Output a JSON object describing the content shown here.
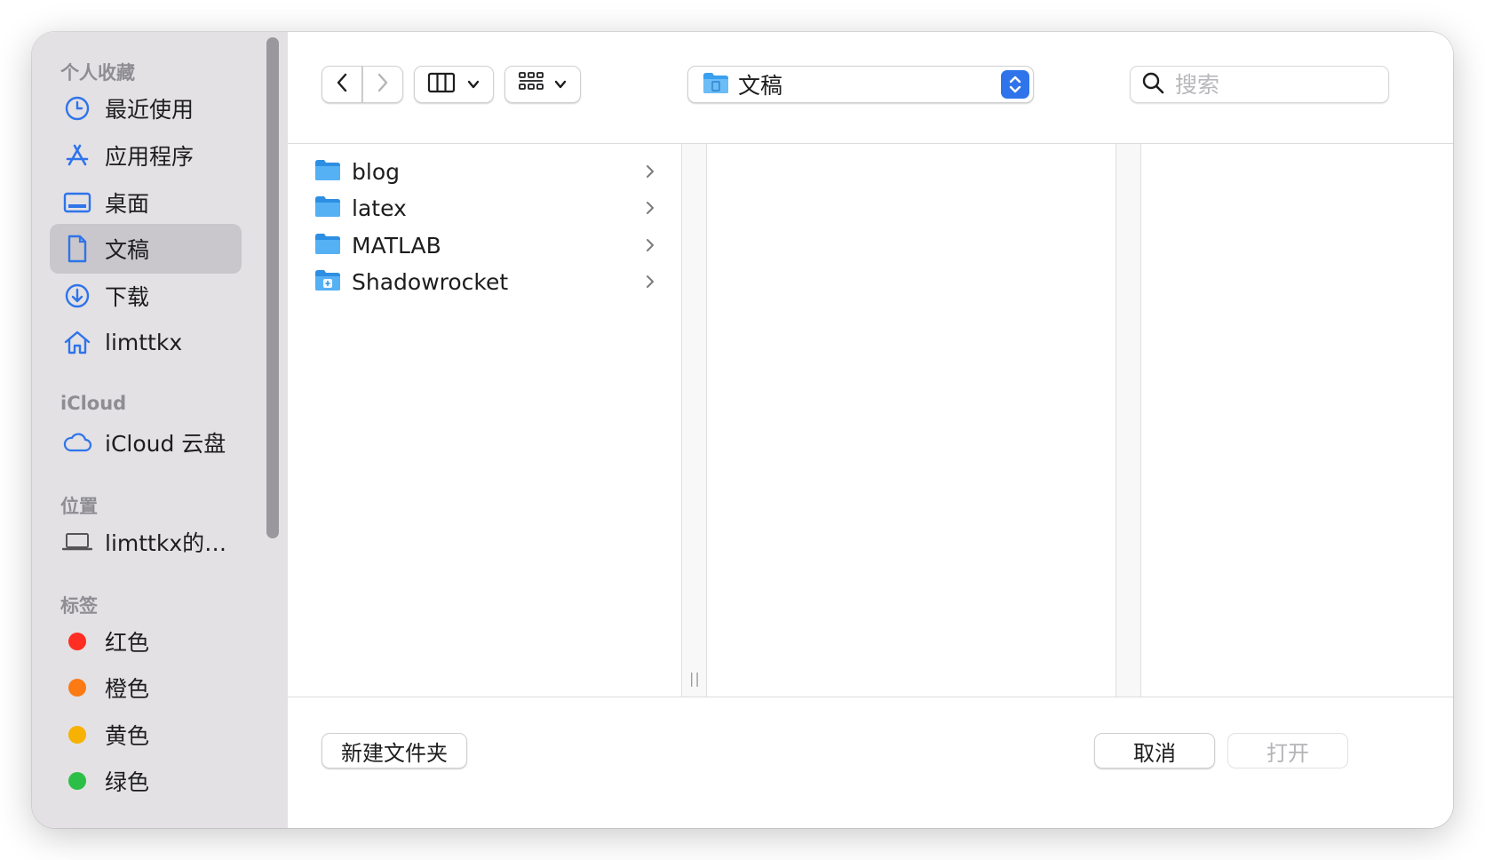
{
  "sidebar": {
    "favorites_header": "个人收藏",
    "favorites": [
      {
        "label": "最近使用",
        "icon": "clock-icon"
      },
      {
        "label": "应用程序",
        "icon": "app-store-icon"
      },
      {
        "label": "桌面",
        "icon": "desktop-icon"
      },
      {
        "label": "文稿",
        "icon": "document-icon",
        "selected": true
      },
      {
        "label": "下载",
        "icon": "download-icon"
      },
      {
        "label": "limttkx",
        "icon": "home-icon"
      }
    ],
    "icloud_header": "iCloud",
    "icloud": [
      {
        "label": "iCloud 云盘",
        "icon": "cloud-icon"
      }
    ],
    "locations_header": "位置",
    "locations": [
      {
        "label": "limttkx的…",
        "icon": "laptop-icon"
      }
    ],
    "tags_header": "标签",
    "tags": [
      {
        "label": "红色",
        "color": "#ff2d22"
      },
      {
        "label": "橙色",
        "color": "#fb7a13"
      },
      {
        "label": "黄色",
        "color": "#f7b100"
      },
      {
        "label": "绿色",
        "color": "#2bbf48"
      }
    ]
  },
  "toolbar": {
    "back_icon": "chevron-left-icon",
    "forward_icon": "chevron-right-icon",
    "view_mode_icon": "columns-view-icon",
    "group_icon": "grid-group-icon",
    "path_label": "文稿",
    "search_placeholder": "搜索"
  },
  "browser": {
    "column1": [
      {
        "name": "blog",
        "icon": "folder-icon"
      },
      {
        "name": "latex",
        "icon": "folder-icon"
      },
      {
        "name": "MATLAB",
        "icon": "folder-icon"
      },
      {
        "name": "Shadowrocket",
        "icon": "app-folder-icon"
      }
    ],
    "resize_handle": "||"
  },
  "footer": {
    "new_folder_label": "新建文件夹",
    "cancel_label": "取消",
    "open_label": "打开"
  },
  "colors": {
    "sidebar_bg": "#e3e1e4",
    "selection_bg": "#c9c7cb",
    "accent": "#2f74ea",
    "folder_blue": "#3aa0f0"
  }
}
